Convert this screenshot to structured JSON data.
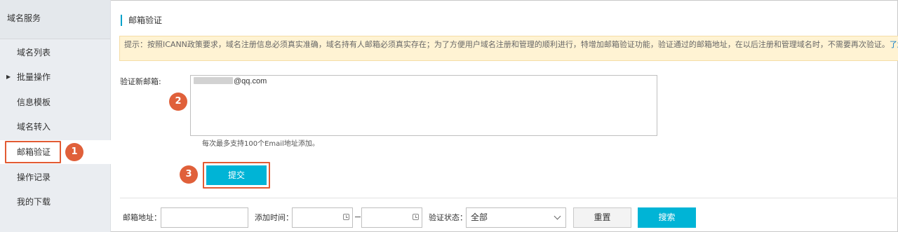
{
  "sidebar": {
    "title": "域名服务",
    "items": [
      {
        "label": "域名列表"
      },
      {
        "label": "批量操作"
      },
      {
        "label": "信息模板"
      },
      {
        "label": "域名转入"
      },
      {
        "label": "邮箱验证"
      },
      {
        "label": "操作记录"
      },
      {
        "label": "我的下载"
      }
    ]
  },
  "page": {
    "title": "邮箱验证",
    "notice": "提示：按照ICANN政策要求，域名注册信息必须真实准确，域名持有人邮箱必须真实存在；为了方便用户域名注册和管理的顺利进行，特增加邮箱验证功能，验证通过的邮箱地址，在以后注册和管理域名时，不需要再次验证。",
    "notice_link": "了解更多"
  },
  "form": {
    "label": "验证新邮箱:",
    "email_suffix": "@qq.com",
    "hint": "每次最多支持100个Email地址添加。",
    "submit_label": "提交"
  },
  "steps": [
    "1",
    "2",
    "3"
  ],
  "filters": {
    "email_label": "邮箱地址：",
    "time_label": "添加时间：",
    "status_label": "验证状态：",
    "status_value": "全部",
    "reset_label": "重置",
    "search_label": "搜索"
  },
  "colors": {
    "accent": "#00b4d6",
    "annotation": "#e0603a",
    "notice_bg": "#fff3d3",
    "link": "#0a79c8"
  }
}
